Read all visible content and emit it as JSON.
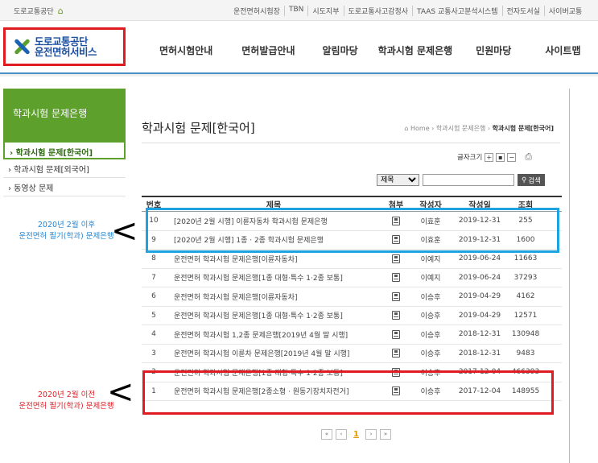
{
  "topbar": {
    "home_label": "도로교통공단",
    "links": [
      "운전면허시험장",
      "TBN",
      "시도지부",
      "도로교통사고감정사",
      "TAAS 교통사고분석시스템",
      "전자도서실",
      "사이버교통"
    ]
  },
  "header": {
    "logo_line1": "도로교통공단",
    "logo_line2": "운전면허서비스",
    "gnb": [
      "면허시험안내",
      "면허발급안내",
      "알림마당",
      "학과시험 문제은행",
      "민원마당",
      "사이트맵"
    ]
  },
  "sidebar": {
    "title": "학과시험 문제은행",
    "items": [
      "› 학과시험 문제[한국어]",
      "› 학과시험 문제[외국어]",
      "› 동영상 문제"
    ]
  },
  "annotations": {
    "after_line1": "2020년 2월 이후",
    "after_line2": "운전면허 필기(학과) 문제은행",
    "before_line1": "2020년 2월 이전",
    "before_line2": "운전면허 필기(학과) 문제은행",
    "brace": "<"
  },
  "main": {
    "title": "학과시험 문제[한국어]",
    "breadcrumb_home": "Home",
    "breadcrumb_mid": "학과시험 문제은행",
    "breadcrumb_current": "학과시험 문제[한국어]",
    "fontsize_label": "글자크기",
    "fontsize_plus": "+",
    "fontsize_mid": "▪",
    "fontsize_minus": "−",
    "print_icon": "⎙",
    "search_select": "제목",
    "search_button": "검색",
    "columns": [
      "번호",
      "제목",
      "첨부",
      "작성자",
      "작성일",
      "조회"
    ],
    "rows": [
      {
        "no": "10",
        "title": "[2020년 2월 시행] 이륜자동차 학과시험 문제은행",
        "author": "이효훈",
        "date": "2019-12-31",
        "views": "255"
      },
      {
        "no": "9",
        "title": "[2020년 2월 시행] 1종 · 2종 학과시험 문제은행",
        "author": "이효훈",
        "date": "2019-12-31",
        "views": "1600"
      },
      {
        "no": "8",
        "title": "운전면허 학과시험 문제은행[이륜자동차]",
        "author": "이예지",
        "date": "2019-06-24",
        "views": "11663"
      },
      {
        "no": "7",
        "title": "운전면허 학과시험 문제은행[1종 대형·특수 1·2종 보통]",
        "author": "이예지",
        "date": "2019-06-24",
        "views": "37293"
      },
      {
        "no": "6",
        "title": "운전면허 학과시험 문제은행[이륜자동차]",
        "author": "이승후",
        "date": "2019-04-29",
        "views": "4162"
      },
      {
        "no": "5",
        "title": "운전면허 학과시험 문제은행[1종 대형·특수 1·2종 보통]",
        "author": "이승후",
        "date": "2019-04-29",
        "views": "12571"
      },
      {
        "no": "4",
        "title": "운전면허 학과시험 1,2종 문제은행[2019년 4월 말 시행]",
        "author": "이승후",
        "date": "2018-12-31",
        "views": "130948"
      },
      {
        "no": "3",
        "title": "운전면허 학과시험 이륜차 문제은행[2019년 4월 말 시행]",
        "author": "이승후",
        "date": "2018-12-31",
        "views": "9483"
      },
      {
        "no": "2",
        "title": "운전면허 학과시험 문제은행[1종 대형·특수 1·2종 보통]",
        "author": "이승후",
        "date": "2017-12-04",
        "views": "466393"
      },
      {
        "no": "1",
        "title": "운전면허 학과시험 문제은행[2종소형 · 원동기장치자전거]",
        "author": "이승후",
        "date": "2017-12-04",
        "views": "148955"
      }
    ],
    "pager": {
      "first": "«",
      "prev": "‹",
      "page": "1",
      "next": "›",
      "last": "»"
    }
  },
  "colors": {
    "brand_green": "#5da02b",
    "brand_blue": "#1b4fa0",
    "annot_blue": "#1fa3e0",
    "annot_red": "#e01b22"
  }
}
